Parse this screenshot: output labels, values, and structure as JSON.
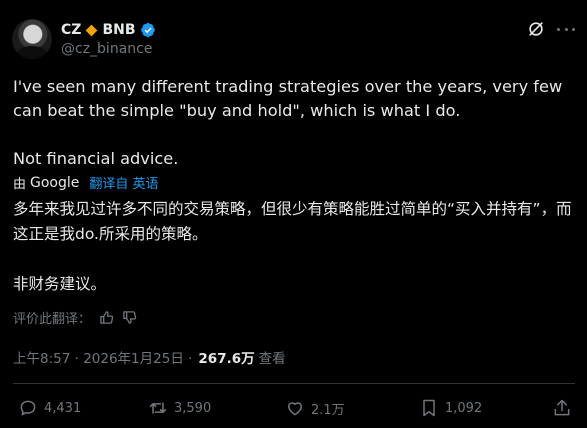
{
  "author": {
    "display_name": "CZ",
    "badge_text": "BNB",
    "handle": "@cz_binance"
  },
  "post": {
    "line1": "I've seen many different trading strategies over the years, very few can beat the simple \"buy and hold\", which is what I do.",
    "line2": "Not financial advice."
  },
  "translation": {
    "by_label": "由",
    "provider": "Google",
    "label": "翻译自 英语",
    "text1": "多年来我见过许多不同的交易策略，但很少有策略能胜过简单的“买入并持有”，而这正是我do.所采用的策略。",
    "text2": "非财务建议。",
    "rate_label": "评价此翻译："
  },
  "meta": {
    "time_date": "上午8:57 · 2026年1月25日 ·",
    "views_count": "267.6万",
    "views_label": "查看"
  },
  "actions": {
    "replies": "4,431",
    "reposts": "3,590",
    "likes": "2.1万",
    "bookmarks": "1,092"
  },
  "colors": {
    "accent": "#1d9bf0",
    "badge_gold": "#f0a30a",
    "muted": "#71767b"
  },
  "icons": [
    "grok-icon",
    "more-icon",
    "reply-icon",
    "repost-icon",
    "like-icon",
    "bookmark-icon",
    "share-icon",
    "thumbs-up-icon",
    "thumbs-down-icon",
    "verified-icon",
    "bnb-diamond-icon"
  ]
}
